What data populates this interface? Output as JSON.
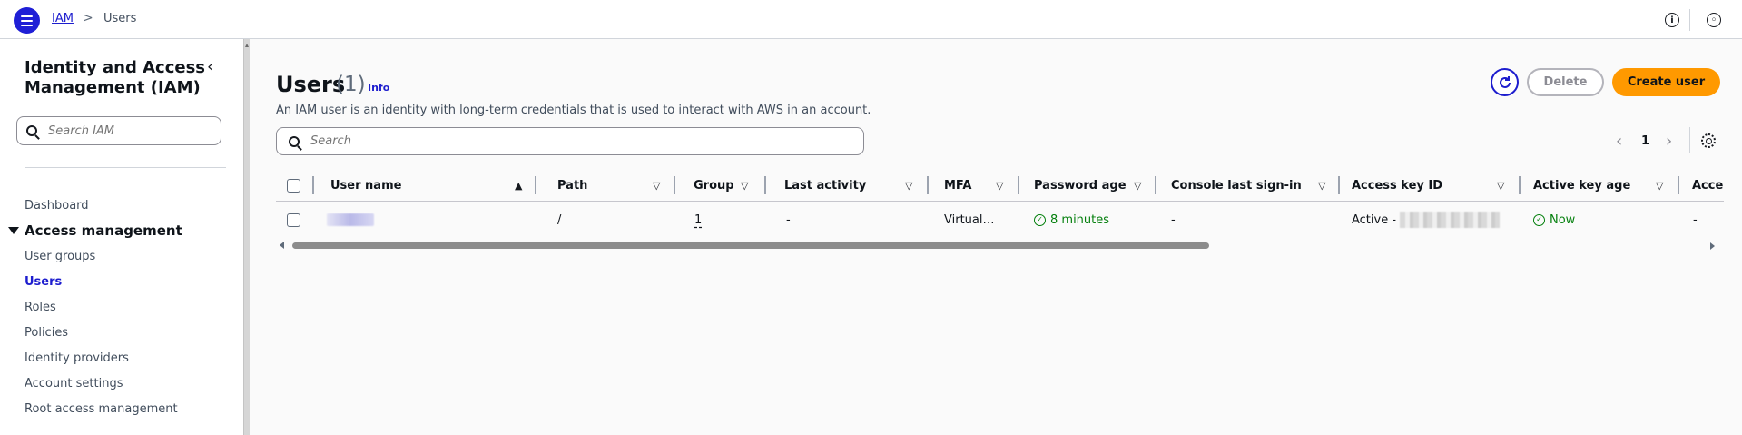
{
  "breadcrumb": {
    "root": "IAM",
    "separator": ">",
    "current": "Users"
  },
  "topbar": {
    "info_icon": "info-icon",
    "settings_icon": "notifications-settings-icon"
  },
  "sidebar": {
    "title": "Identity and Access Management (IAM)",
    "search_placeholder": "Search IAM",
    "dashboard": "Dashboard",
    "section": "Access management",
    "items": [
      {
        "label": "User groups",
        "active": false
      },
      {
        "label": "Users",
        "active": true
      },
      {
        "label": "Roles",
        "active": false
      },
      {
        "label": "Policies",
        "active": false
      },
      {
        "label": "Identity providers",
        "active": false
      },
      {
        "label": "Account settings",
        "active": false
      },
      {
        "label": "Root access management",
        "active": false
      }
    ]
  },
  "header": {
    "title": "Users",
    "count": "(1)",
    "info": "Info",
    "description": "An IAM user is an identity with long-term credentials that is used to interact with AWS in an account.",
    "delete_label": "Delete",
    "create_label": "Create user"
  },
  "search": {
    "placeholder": "Search"
  },
  "pagination": {
    "prev": "<",
    "page": "1",
    "next": ">"
  },
  "table": {
    "columns": [
      "User name",
      "Path",
      "Groups",
      "Last activity",
      "MFA",
      "Password age",
      "Console last sign-in",
      "Access key ID",
      "Active key age",
      "Acce"
    ],
    "rows": [
      {
        "path": "/",
        "groups": "1",
        "last_activity": "-",
        "mfa": "Virtual…",
        "password_age": "8 minutes",
        "console_last_signin": "-",
        "access_key_prefix": "Active -",
        "active_key_age": "Now",
        "access_last": "-"
      }
    ]
  },
  "colors": {
    "accent": "#1d1dce",
    "primary_button": "#ff9900",
    "success": "#037f0c"
  }
}
